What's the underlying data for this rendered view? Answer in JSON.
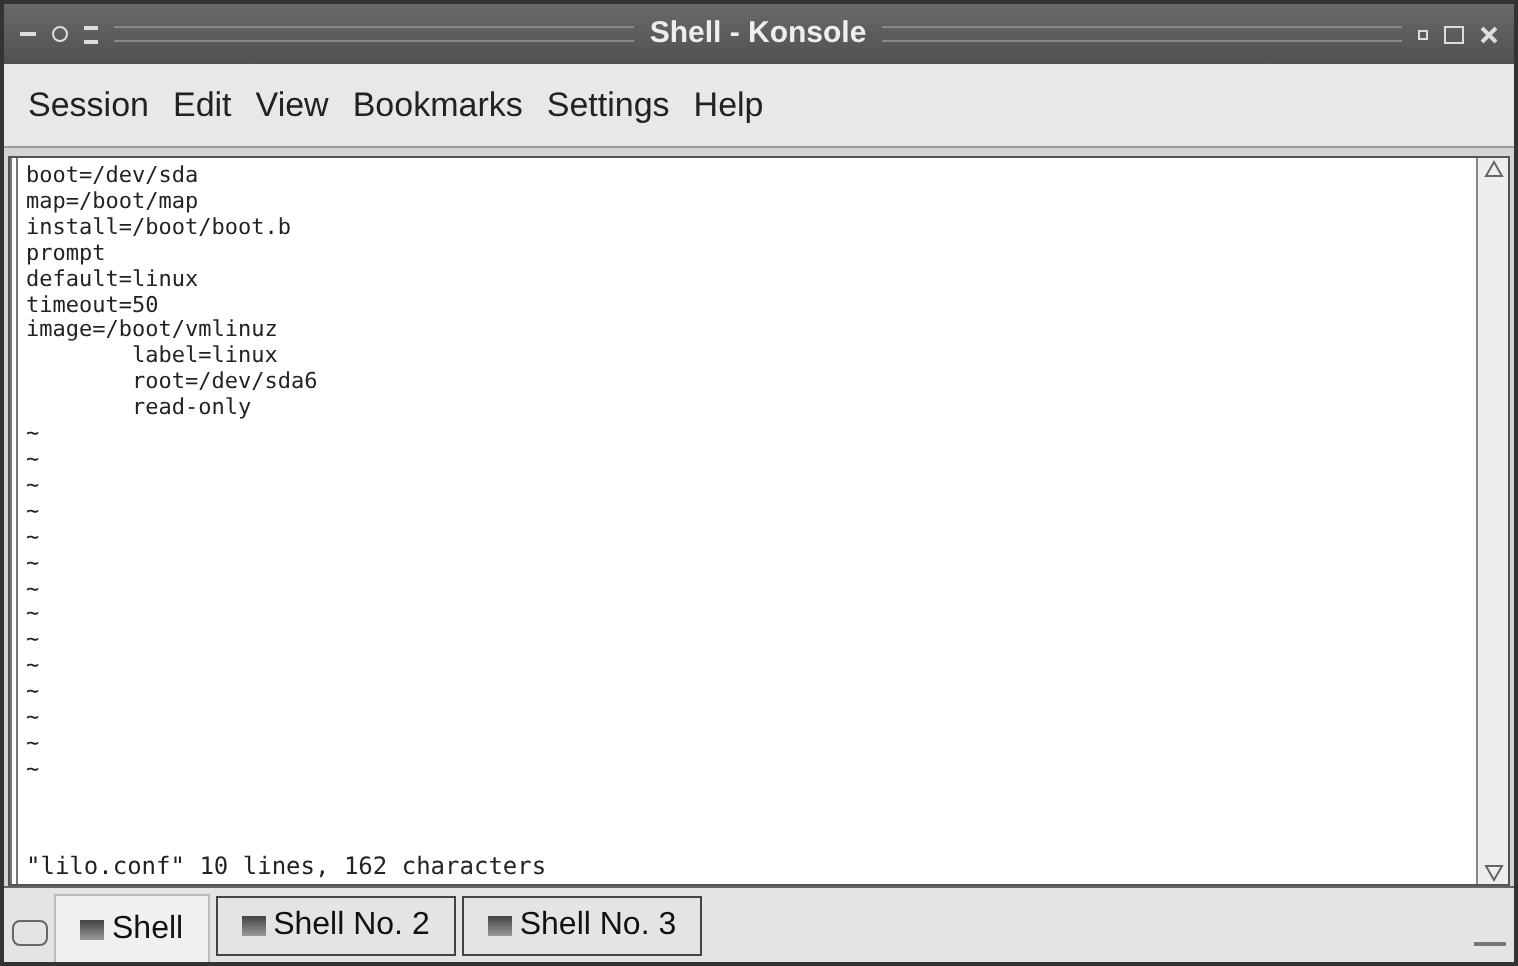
{
  "window": {
    "title": "Shell - Konsole"
  },
  "menu": [
    "Session",
    "Edit",
    "View",
    "Bookmarks",
    "Settings",
    "Help"
  ],
  "terminal": {
    "lines": [
      "boot=/dev/sda",
      "map=/boot/map",
      "install=/boot/boot.b",
      "prompt",
      "default=linux",
      "timeout=50",
      "image=/boot/vmlinuz",
      "        label=linux",
      "        root=/dev/sda6",
      "        read-only",
      "~",
      "~",
      "~",
      "~",
      "~",
      "~",
      "~",
      "~",
      "~",
      "~",
      "~",
      "~",
      "~",
      "~"
    ],
    "status": "\"lilo.conf\" 10 lines, 162 characters"
  },
  "tabs": [
    {
      "label": "Shell",
      "selected": true
    },
    {
      "label": "Shell No. 2",
      "selected": false
    },
    {
      "label": "Shell No. 3",
      "selected": false
    }
  ]
}
